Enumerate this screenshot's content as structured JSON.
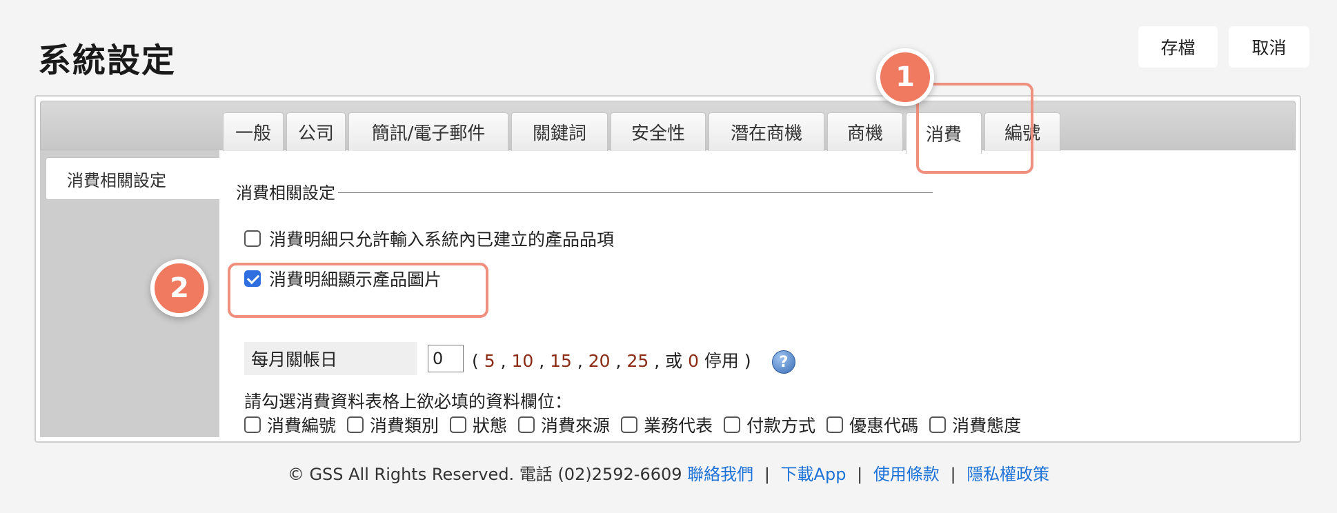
{
  "header": {
    "title": "系統設定",
    "save_label": "存檔",
    "cancel_label": "取消"
  },
  "tabs": [
    {
      "label": "一般"
    },
    {
      "label": "公司"
    },
    {
      "label": "簡訊/電子郵件"
    },
    {
      "label": "關鍵詞"
    },
    {
      "label": "安全性"
    },
    {
      "label": "潛在商機"
    },
    {
      "label": "商機"
    },
    {
      "label": "消費",
      "active": true
    },
    {
      "label": "編號"
    }
  ],
  "sidebar": {
    "items": [
      {
        "label": "消費相關設定"
      }
    ]
  },
  "section": {
    "legend": "消費相關設定",
    "option1": {
      "label": "消費明細只允許輸入系統內已建立的產品品項",
      "checked": false
    },
    "option2": {
      "label": "消費明細顯示產品圖片",
      "checked": true
    },
    "closing_day": {
      "label": "每月關帳日",
      "value": "0",
      "hint_open": "(",
      "choices": [
        "5",
        "10",
        "15",
        "20",
        "25"
      ],
      "or_text": "或",
      "disable_value": "0",
      "disable_text": "停用",
      "hint_close": ")"
    },
    "required_title": "請勾選消費資料表格上欲必填的資料欄位：",
    "required_fields": [
      {
        "label": "消費編號",
        "checked": false
      },
      {
        "label": "消費類別",
        "checked": false
      },
      {
        "label": "狀態",
        "checked": false
      },
      {
        "label": "消費來源",
        "checked": false
      },
      {
        "label": "業務代表",
        "checked": false
      },
      {
        "label": "付款方式",
        "checked": false
      },
      {
        "label": "優惠代碼",
        "checked": false
      },
      {
        "label": "消費態度",
        "checked": false
      }
    ]
  },
  "annotations": {
    "badge1": "1",
    "badge2": "2",
    "highlight_color": "#f08f7d"
  },
  "footer": {
    "copyright": "© GSS All Rights Reserved. 電話 (02)2592-6609",
    "links": [
      "聯絡我們",
      "下載App",
      "使用條款",
      "隱私權政策"
    ],
    "separator": "|"
  }
}
